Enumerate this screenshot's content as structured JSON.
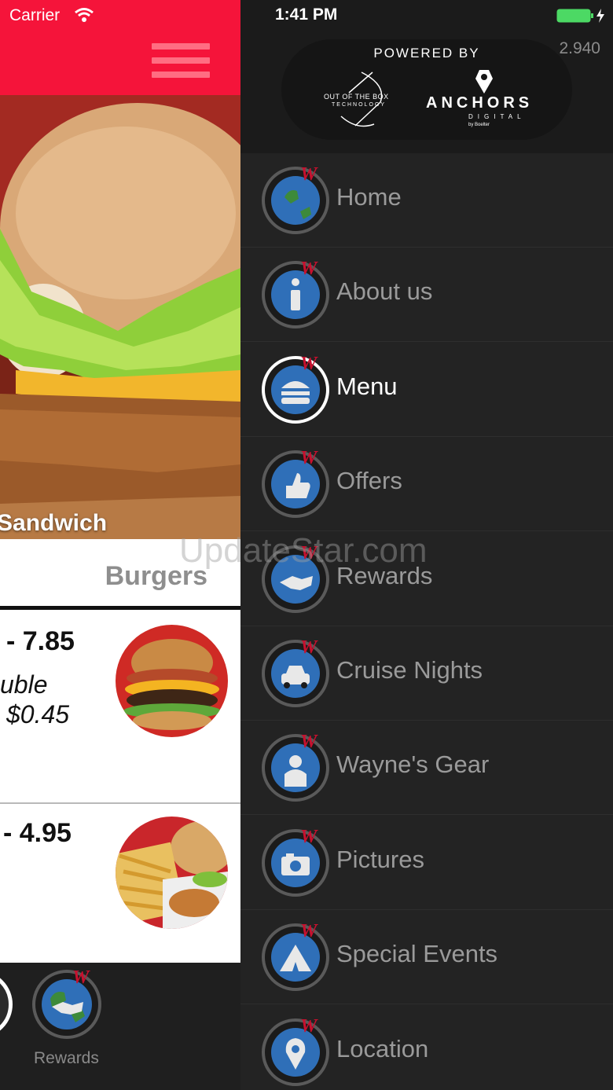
{
  "status_bar": {
    "carrier": "Carrier",
    "time": "1:41 PM"
  },
  "hero": {
    "title": "Sandwich"
  },
  "category": {
    "label": "Burgers"
  },
  "menu_items": [
    {
      "price": "- 7.85",
      "note_1": "uble",
      "note_2": "$0.45"
    },
    {
      "price": "- 4.95"
    }
  ],
  "tabbar": {
    "rewards_label": "Rewards"
  },
  "watermark": "UpdateStar.com",
  "drawer": {
    "version": "2.940",
    "powered_by": "POWERED BY",
    "brand_1": "OUT OF THE BOX",
    "brand_1_sub": "TECHNOLOGY",
    "brand_2": "ANCHORS",
    "brand_2_sub": "DIGITAL",
    "brand_2_by": "by Boelter",
    "items": [
      {
        "label": "Home",
        "icon": "globe-icon",
        "active": false
      },
      {
        "label": "About us",
        "icon": "info-icon",
        "active": false
      },
      {
        "label": "Menu",
        "icon": "burger-icon",
        "active": true
      },
      {
        "label": "Offers",
        "icon": "thumbs-up-icon",
        "active": false
      },
      {
        "label": "Rewards",
        "icon": "handshake-icon",
        "active": false
      },
      {
        "label": "Cruise Nights",
        "icon": "car-icon",
        "active": false
      },
      {
        "label": "Wayne's Gear",
        "icon": "shirt-icon",
        "active": false
      },
      {
        "label": "Pictures",
        "icon": "camera-icon",
        "active": false
      },
      {
        "label": "Special Events",
        "icon": "tent-icon",
        "active": false
      },
      {
        "label": "Location",
        "icon": "map-pin-icon",
        "active": false
      }
    ]
  },
  "colors": {
    "header_red": "#f5143a",
    "drawer_bg": "#232323",
    "globe_blue": "#2f6fb8",
    "accent_red": "#c8102e"
  }
}
